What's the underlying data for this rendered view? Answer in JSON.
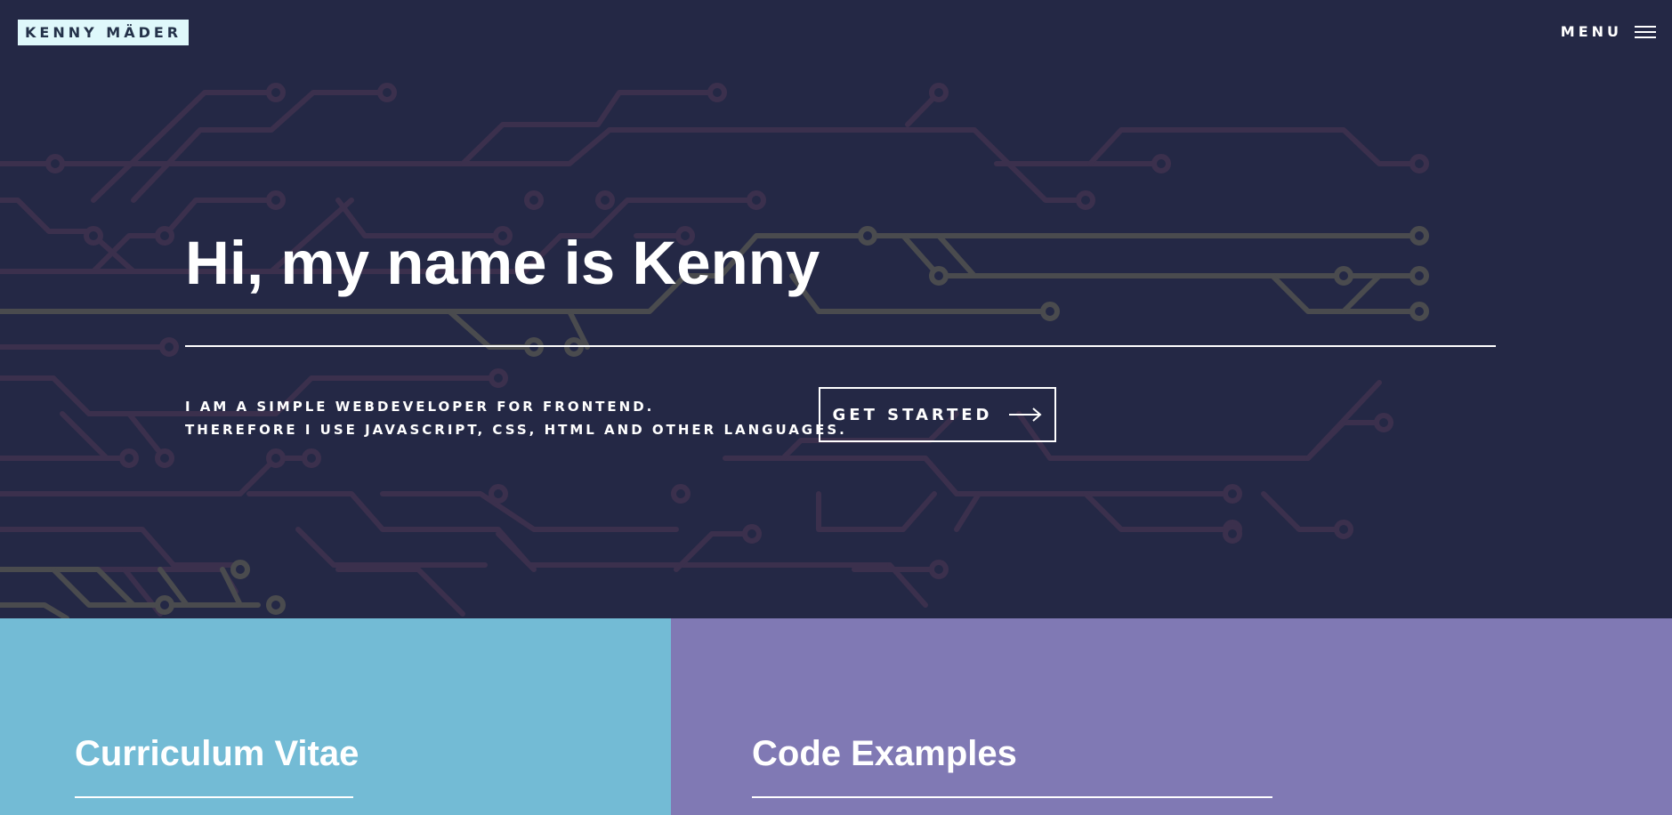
{
  "header": {
    "logo_text": "KENNY MÄDER",
    "menu_label": "MENU",
    "menu_icon": "hamburger-icon"
  },
  "hero": {
    "headline": "Hi, my name is Kenny",
    "intro_lines": [
      "I AM A SIMPLE WEBDEVELOPER FOR FRONTEND.",
      "THEREFORE I USE JAVASCRIPT, CSS, HTML AND OTHER LANGUAGES."
    ],
    "cta_label": "GET STARTED",
    "cta_icon": "arrow-right-icon",
    "background_pattern": "circuit-board"
  },
  "cards": [
    {
      "title": "Curriculum Vitae",
      "color": "#73bbd5"
    },
    {
      "title": "Code Examples",
      "color": "#8079b4"
    }
  ],
  "colors": {
    "hero_background": "#242845",
    "logo_background": "#dff8fb",
    "logo_text": "#24324a",
    "circuit_purple": "#3b304d",
    "circuit_gray": "#4a4b4e"
  }
}
